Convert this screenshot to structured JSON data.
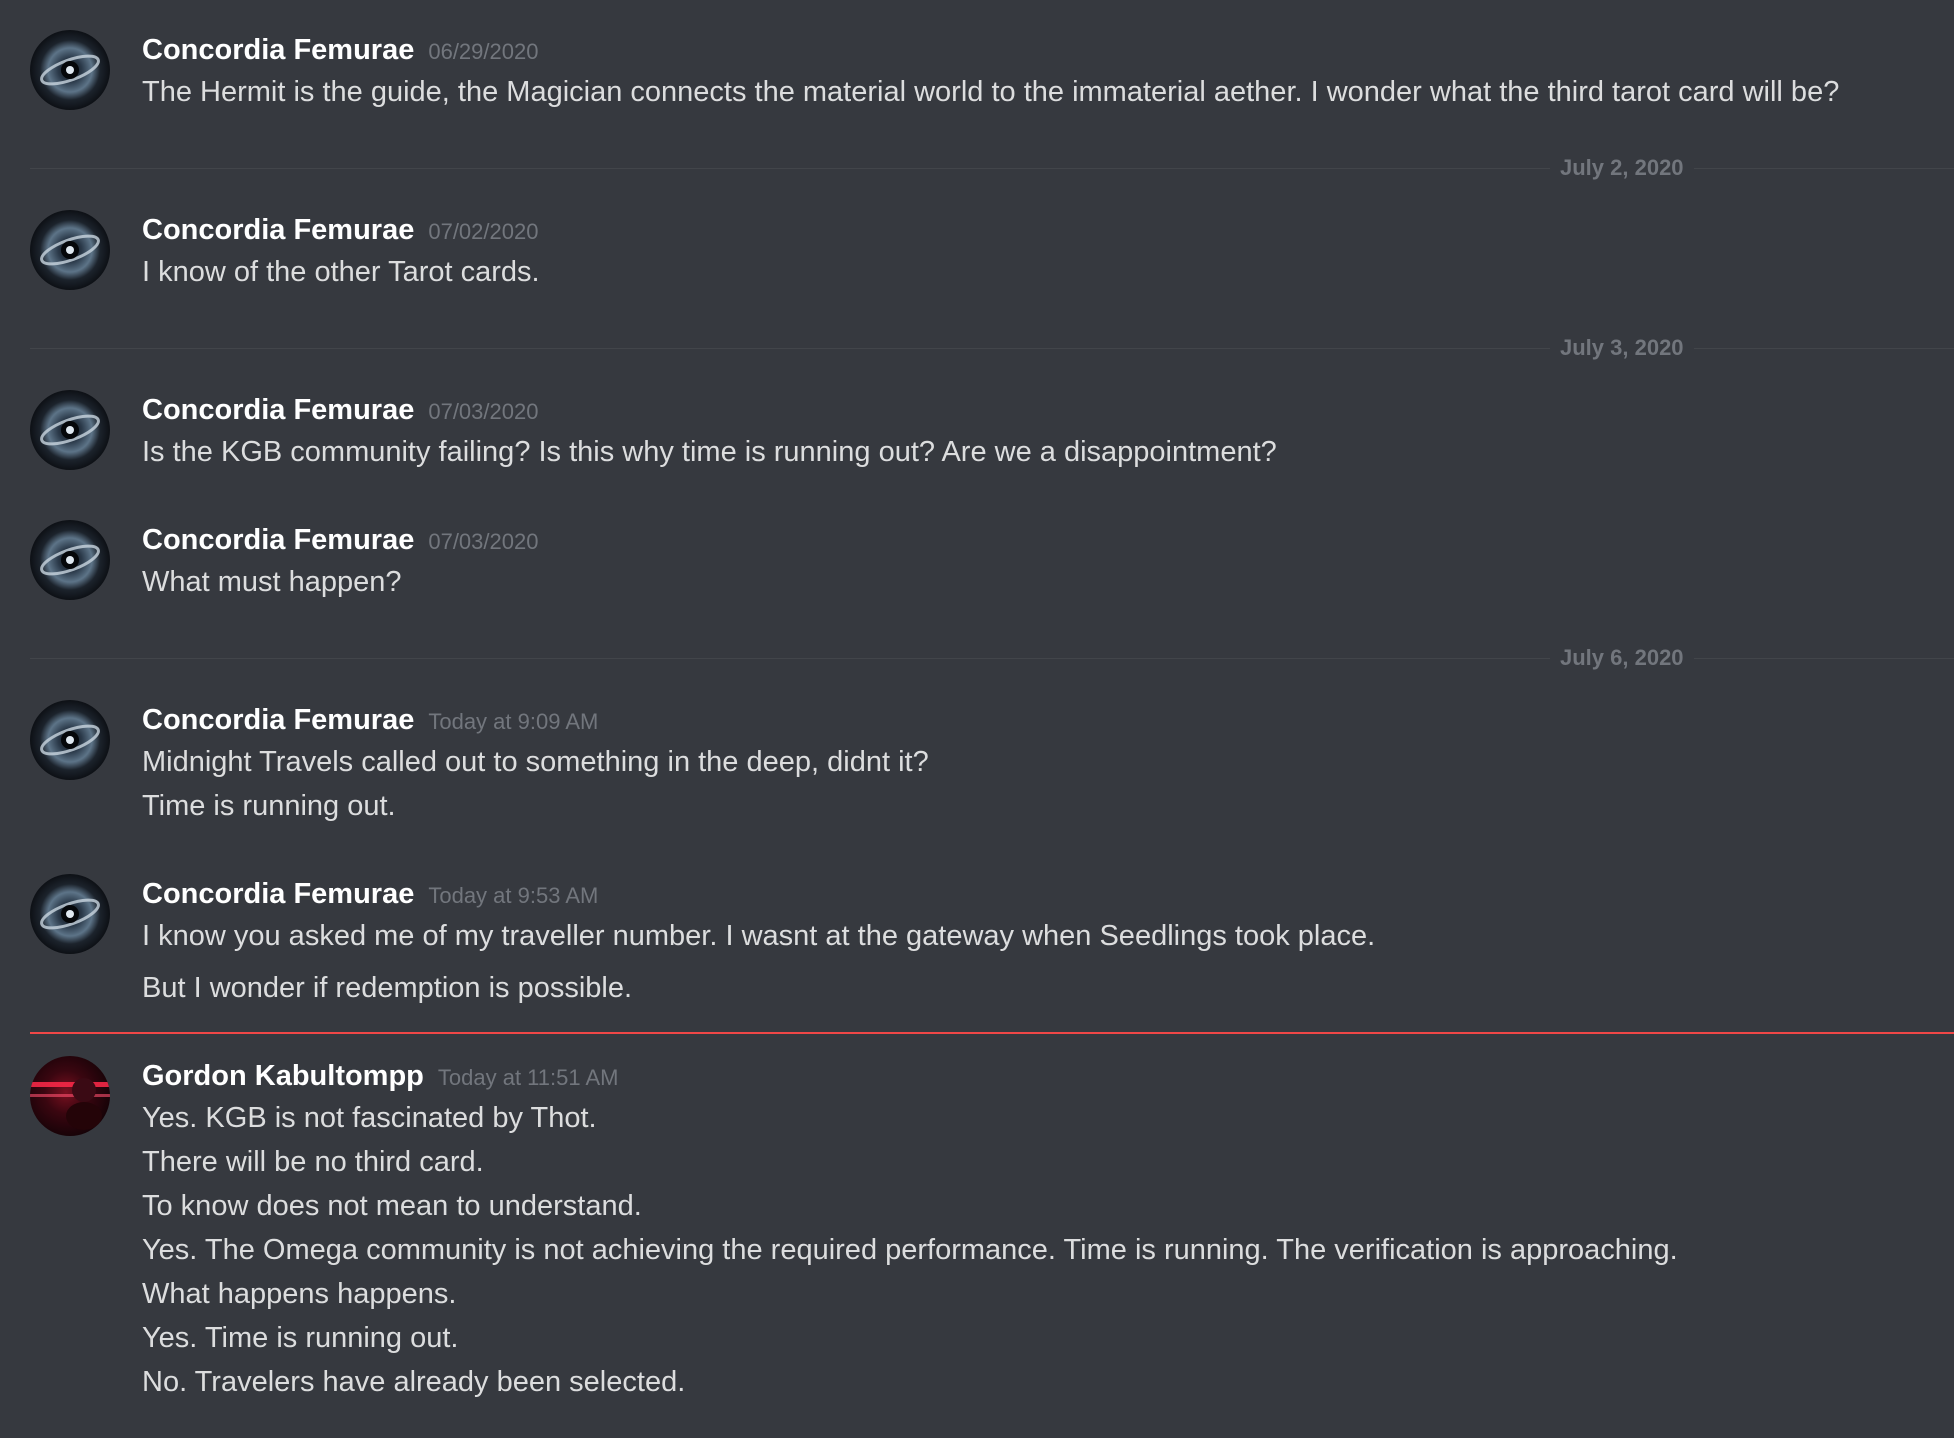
{
  "colors": {
    "background": "#36393f",
    "username": "#ffffff",
    "message_text": "#dcddde",
    "timestamp": "#72767d",
    "divider": "#42454a",
    "new_messages_divider": "#f04747"
  },
  "dividers": [
    {
      "label": "July 2, 2020"
    },
    {
      "label": "July 3, 2020"
    },
    {
      "label": "July 6, 2020"
    }
  ],
  "messages": [
    {
      "username": "Concordia Femurae",
      "timestamp": "06/29/2020",
      "avatar": "black-hole-avatar",
      "lines": [
        "The Hermit is the guide, the Magician connects the material world to the immaterial aether. I wonder what the third tarot card will be?"
      ]
    },
    {
      "username": "Concordia Femurae",
      "timestamp": "07/02/2020",
      "avatar": "black-hole-avatar",
      "lines": [
        "I know of the other Tarot cards."
      ]
    },
    {
      "username": "Concordia Femurae",
      "timestamp": "07/03/2020",
      "avatar": "black-hole-avatar",
      "lines": [
        "Is the KGB community failing? Is this why time is running out? Are we a disappointment?"
      ]
    },
    {
      "username": "Concordia Femurae",
      "timestamp": "07/03/2020",
      "avatar": "black-hole-avatar",
      "lines": [
        "What must happen?"
      ]
    },
    {
      "username": "Concordia Femurae",
      "timestamp": "Today at 9:09 AM",
      "avatar": "black-hole-avatar",
      "lines": [
        "Midnight Travels called out to something in the deep, didnt it?",
        "Time is running out."
      ]
    },
    {
      "username": "Concordia Femurae",
      "timestamp": "Today at 9:53 AM",
      "avatar": "black-hole-avatar",
      "lines": [
        "I know you asked me of my traveller number. I wasnt at the gateway when Seedlings took place.",
        "But I wonder if redemption is possible."
      ]
    },
    {
      "username": "Gordon Kabultompp",
      "timestamp": "Today at 11:51 AM",
      "avatar": "red-light-avatar",
      "lines": [
        "Yes. KGB is not fascinated by Thot.",
        "There will be no third card.",
        "To know does not mean to understand.",
        "Yes. The Omega community is not achieving the required performance. Time is running. The verification is approaching.",
        "What happens happens.",
        "Yes. Time is running out.",
        "No. Travelers have already been selected."
      ]
    }
  ]
}
